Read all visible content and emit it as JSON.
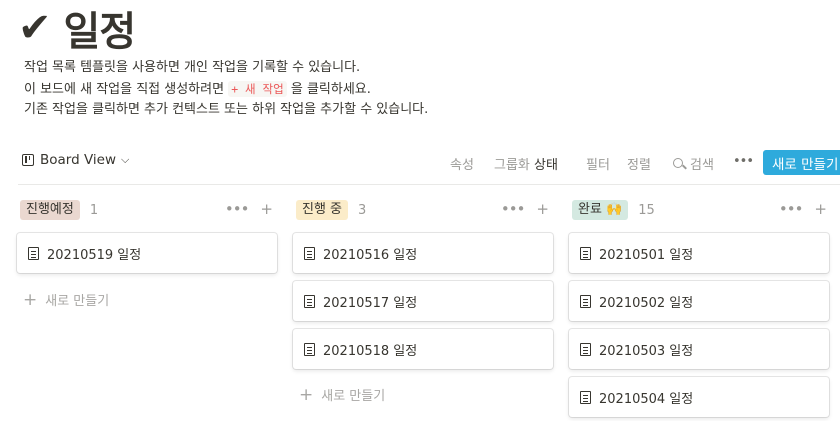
{
  "page": {
    "check": "✔",
    "title": "일정",
    "description": {
      "line1": "작업 목록 템플릿을 사용하면 개인 작업을 기록할 수 있습니다.",
      "line2_pre": "이 보드에 새 작업을 직접 생성하려면 ",
      "line2_code": "+ 새 작업",
      "line2_post": " 을 클릭하세요.",
      "line3": "기존 작업을 클릭하면 추가 컨텍스트 또는 하위 작업을 추가할 수 있습니다."
    }
  },
  "toolbar": {
    "view_label": "Board View",
    "properties": "속성",
    "group_prefix": "그룹화",
    "group_value": "상태",
    "filter": "필터",
    "sort": "정렬",
    "search": "검색",
    "more": "•••",
    "new_button": "새로 만들기"
  },
  "columns": [
    {
      "tag": "진행예정",
      "tag_color": "#ead8d0",
      "count": "1",
      "cards": [
        "20210519 일정"
      ],
      "add_new": "새로 만들기"
    },
    {
      "tag": "진행 중",
      "tag_color": "#fbecc9",
      "count": "3",
      "cards": [
        "20210516 일정",
        "20210517 일정",
        "20210518 일정"
      ],
      "add_new": "새로 만들기"
    },
    {
      "tag": "완료 🙌",
      "tag_color": "#d4e9e1",
      "count": "15",
      "cards": [
        "20210501 일정",
        "20210502 일정",
        "20210503 일정",
        "20210504 일정"
      ],
      "add_new": ""
    }
  ],
  "colors": {
    "accent": "#2eaadc",
    "text": "#37352f",
    "muted": "#9b9a97"
  }
}
